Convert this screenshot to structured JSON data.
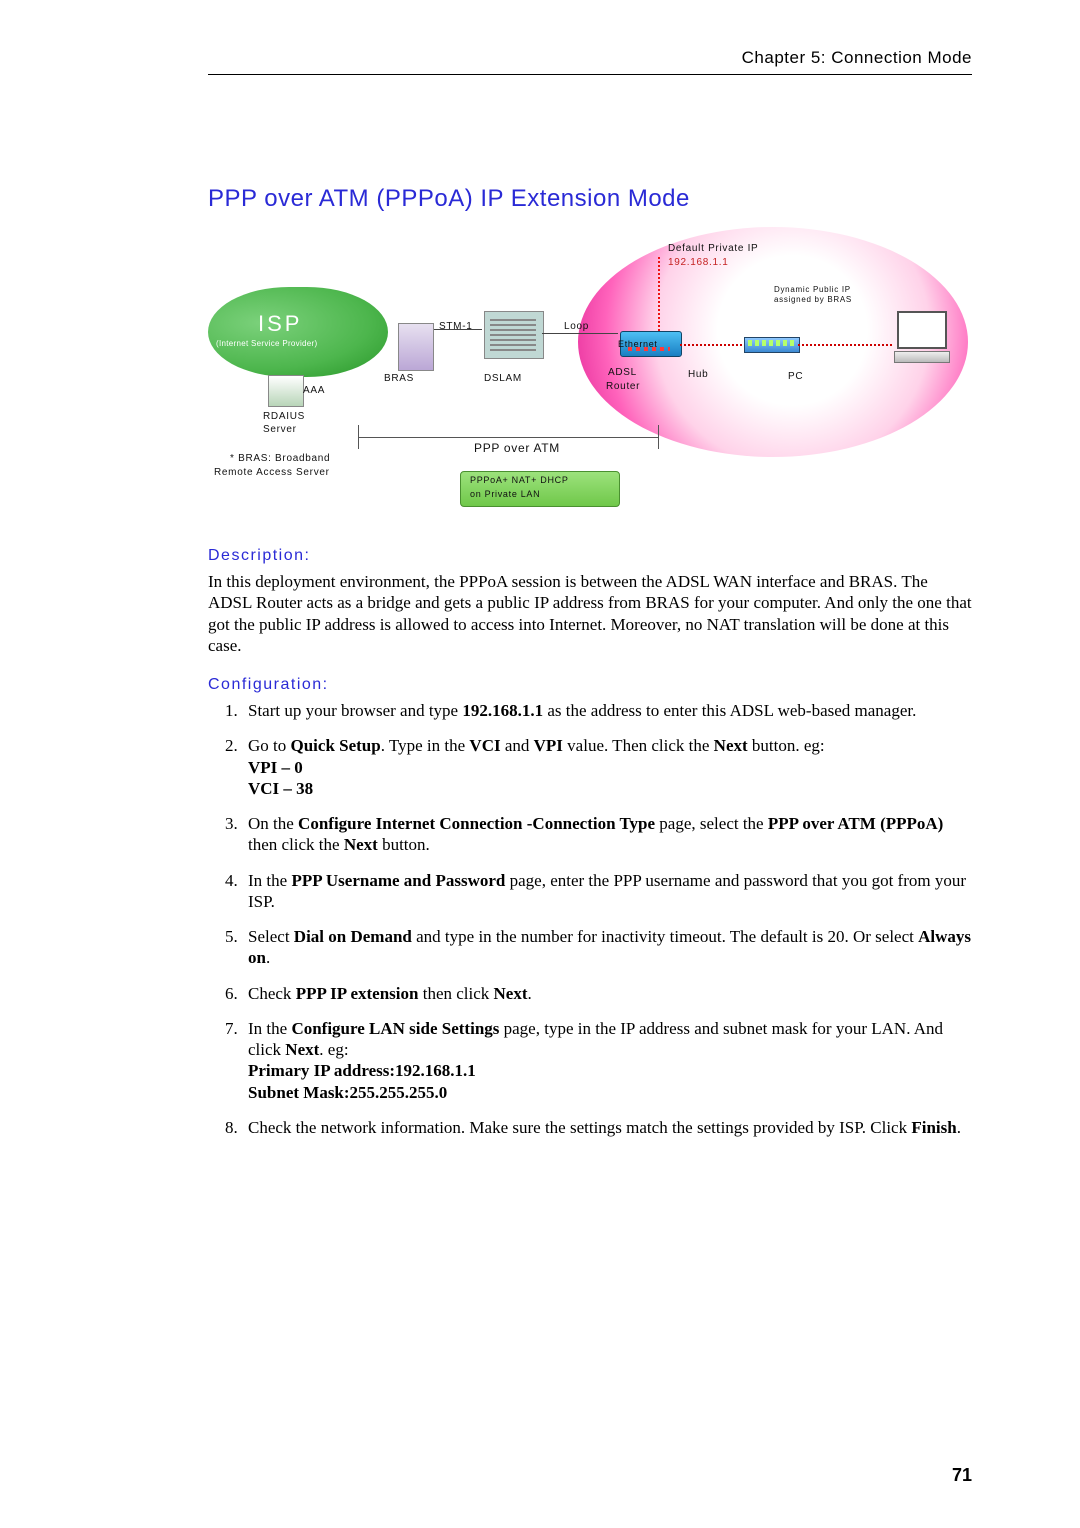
{
  "header": {
    "chapter": "Chapter 5: Connection Mode"
  },
  "title": "PPP over ATM (PPPoA) IP Extension Mode",
  "diagram": {
    "isp": "ISP",
    "isp_sub": "(Internet Service Provider)",
    "aaa": "AAA",
    "radius1": "RDAIUS",
    "radius2": "Server",
    "bras": "BRAS",
    "stm": "STM-1",
    "dslam": "DSLAM",
    "loop": "Loop",
    "adsl1": "ADSL",
    "adsl2": "Router",
    "hub": "Hub",
    "pc": "PC",
    "ethernet": "Ethernet",
    "default_ip_label": "Default Private IP",
    "default_ip_value": "192.168.1.1",
    "dynamic1": "Dynamic Public IP",
    "dynamic2": "assigned by BRAS",
    "bras_note1": "* BRAS: Broadband",
    "bras_note2": "Remote Access Server",
    "ppp_over_atm": "PPP over ATM",
    "green1": "PPPoA+ NAT+ DHCP",
    "green2": "on Private LAN"
  },
  "sections": {
    "description_head": "Description:",
    "description_body": "In this deployment environment, the PPPoA session is between the ADSL WAN interface and BRAS. The ADSL Router acts as a bridge and gets a public IP address from BRAS for your computer. And only the one that got the public IP address is allowed to access into Internet. Moreover, no NAT translation will be done at this case.",
    "configuration_head": "Configuration:",
    "steps": {
      "s1a": "Start up your browser and type ",
      "s1b": "192.168.1.1",
      "s1c": " as the address to enter this ADSL web-based manager.",
      "s2a": "Go to ",
      "s2b": "Quick Setup",
      "s2c": ". Type in the ",
      "s2d": "VCI",
      "s2e": " and ",
      "s2f": "VPI",
      "s2g": " value. Then click the ",
      "s2h": "Next",
      "s2i": " button.    eg:",
      "s2j": "VPI – 0",
      "s2k": "VCI – 38",
      "s3a": "On the ",
      "s3b": "Configure Internet Connection -Connection Type",
      "s3c": " page, select the ",
      "s3d": "PPP over ATM (PPPoA)",
      "s3e": " then click the ",
      "s3f": "Next",
      "s3g": " button.",
      "s4a": "In the ",
      "s4b": "PPP Username and Password",
      "s4c": " page, enter the PPP username and password that you got from your ISP.",
      "s5a": "Select ",
      "s5b": "Dial on Demand",
      "s5c": " and type in the number for inactivity timeout. The default is 20. Or select ",
      "s5d": "Always on",
      "s5e": ".",
      "s6a": "Check ",
      "s6b": "PPP IP extension",
      "s6c": " then click ",
      "s6d": "Next",
      "s6e": ".",
      "s7a": "In the ",
      "s7b": "Configure LAN side Settings",
      "s7c": " page, type in the IP address and subnet mask for your LAN. And click ",
      "s7d": "Next",
      "s7e": ". eg:",
      "s7f": "Primary IP address:192.168.1.1",
      "s7g": "Subnet Mask:255.255.255.0",
      "s8a": "Check the network information. Make sure the settings match the settings provided by ISP. Click ",
      "s8b": "Finish",
      "s8c": "."
    }
  },
  "page_number": "71"
}
